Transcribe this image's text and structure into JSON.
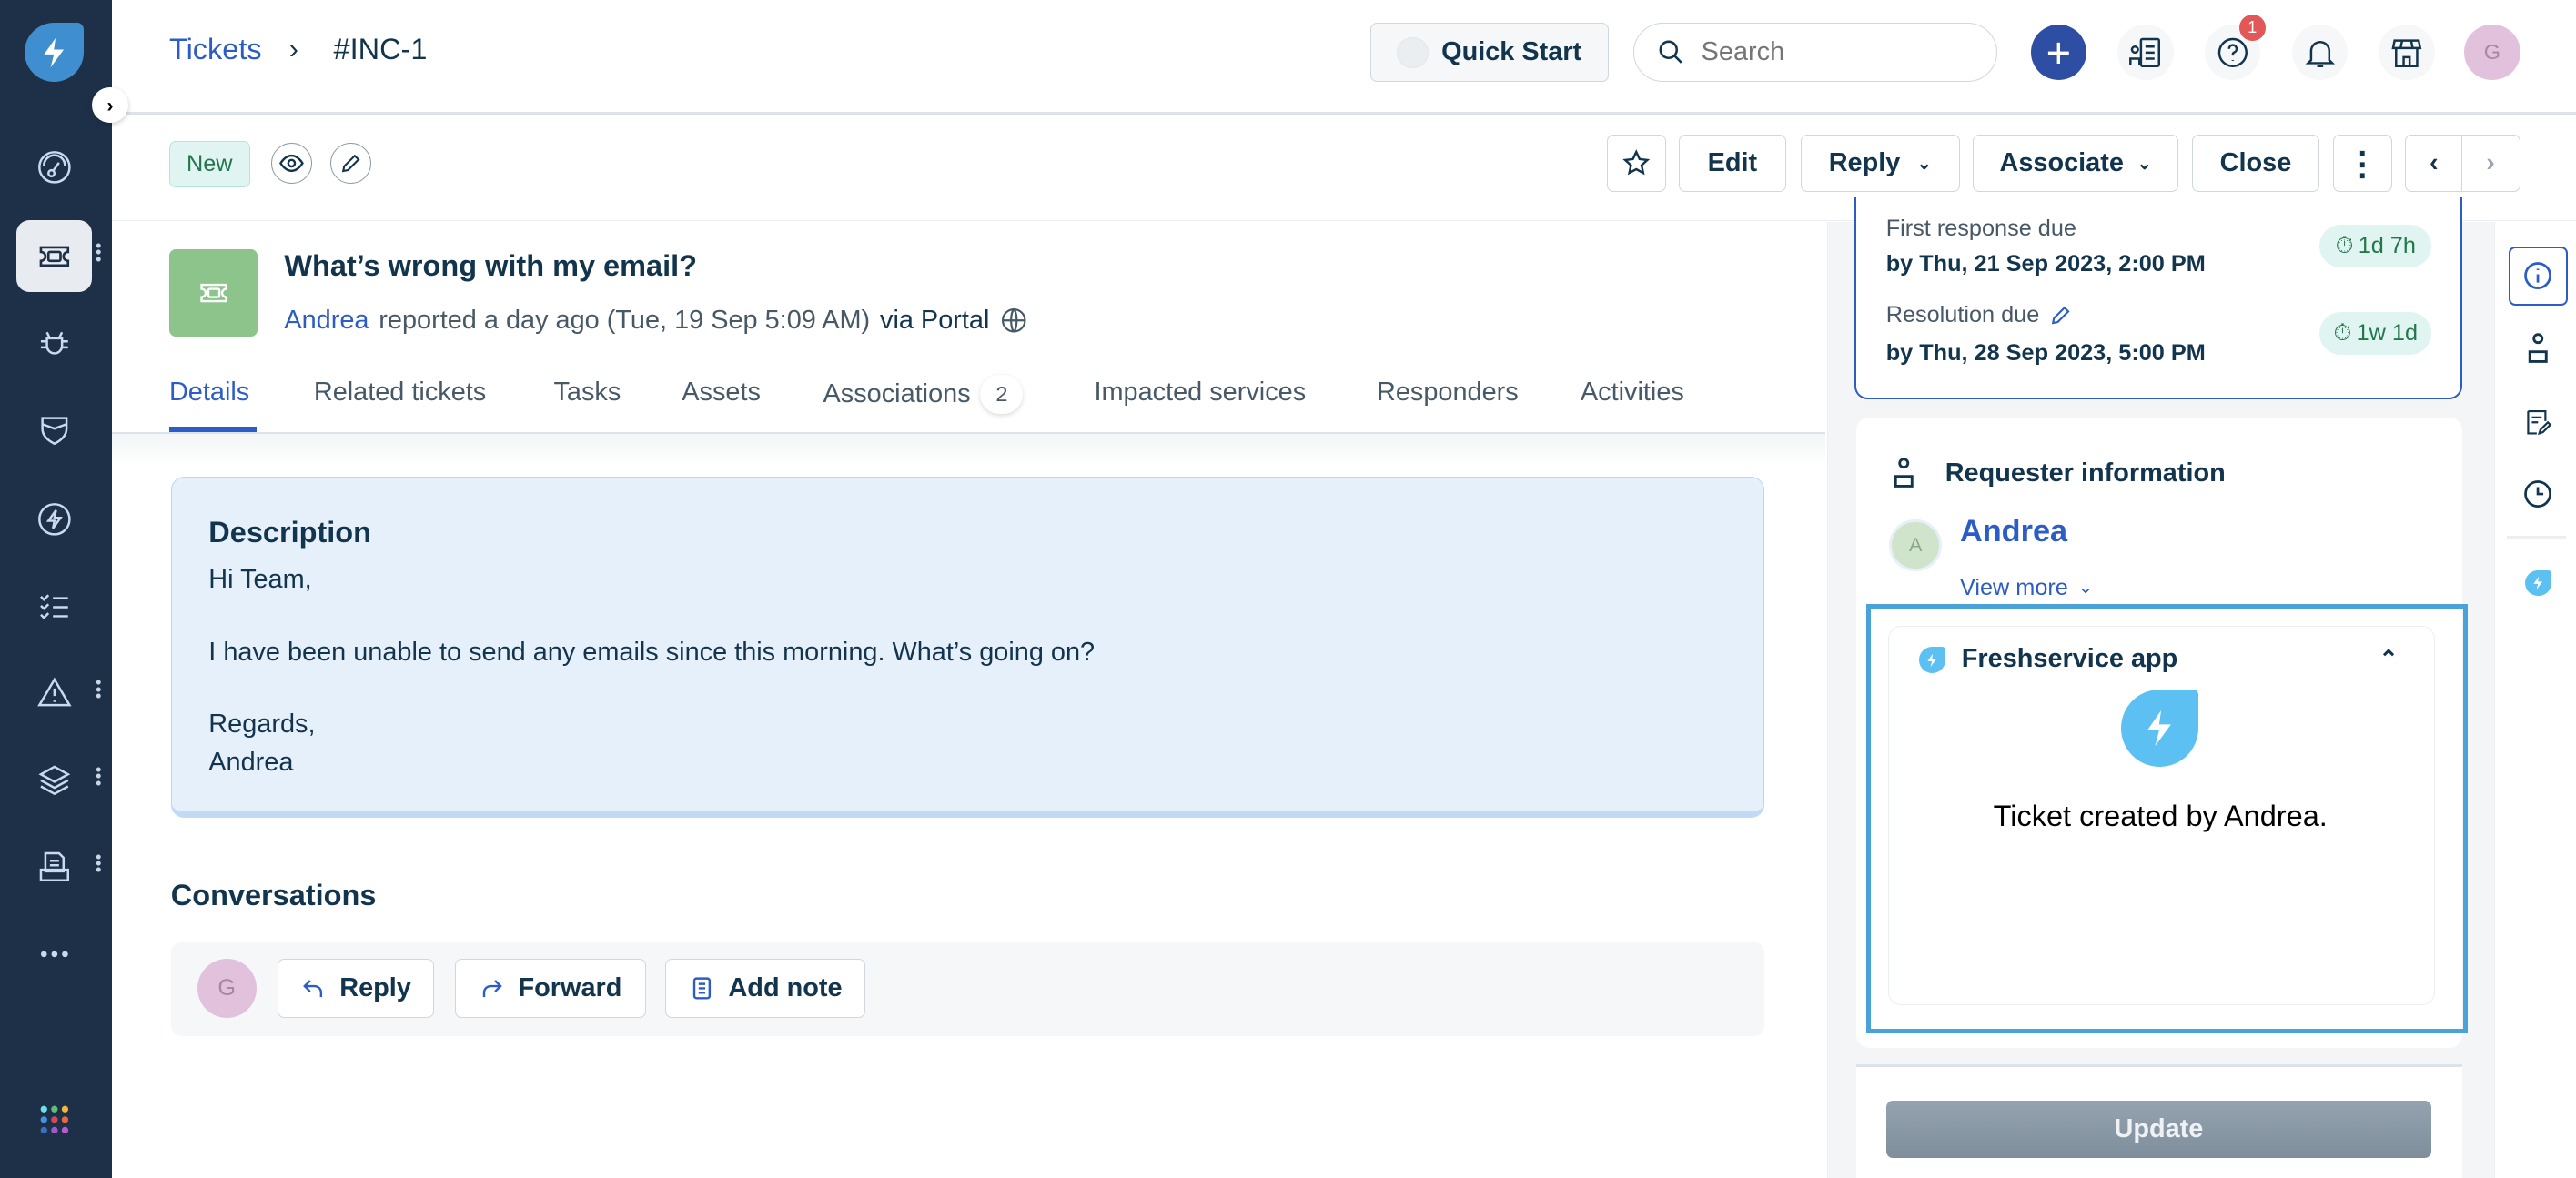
{
  "header": {
    "breadcrumb": {
      "parent": "Tickets",
      "separator": "›",
      "current": "#INC-1"
    },
    "quick_start": "Quick Start",
    "search_placeholder": "Search",
    "notification_badge": "1",
    "user_initial": "G"
  },
  "ticket_bar": {
    "status": "New",
    "buttons": {
      "edit": "Edit",
      "reply": "Reply",
      "associate": "Associate",
      "close": "Close"
    }
  },
  "ticket": {
    "subject": "What’s wrong with my email?",
    "requester": "Andrea",
    "reported_text": "reported a day ago (Tue, 19 Sep 5:09 AM)",
    "via_text": "via Portal"
  },
  "tabs": [
    {
      "label": "Details",
      "active": true
    },
    {
      "label": "Related tickets"
    },
    {
      "label": "Tasks"
    },
    {
      "label": "Assets"
    },
    {
      "label": "Associations",
      "count": "2"
    },
    {
      "label": "Impacted services"
    },
    {
      "label": "Responders"
    },
    {
      "label": "Activities"
    }
  ],
  "description": {
    "title": "Description",
    "lines": [
      "Hi Team,",
      "I have been unable to send any emails since this morning. What’s going on?",
      "Regards,",
      "Andrea"
    ]
  },
  "conversations": {
    "title": "Conversations",
    "avatar_initial": "G",
    "buttons": {
      "reply": "Reply",
      "forward": "Forward",
      "add_note": "Add note"
    }
  },
  "sla": {
    "first_response": {
      "label": "First response due",
      "date": "by Thu, 21 Sep 2023, 2:00 PM",
      "remaining": "1d 7h"
    },
    "resolution": {
      "label": "Resolution due",
      "date": "by Thu, 28 Sep 2023, 5:00 PM",
      "remaining": "1w 1d"
    }
  },
  "requester_info": {
    "title": "Requester information",
    "initial": "A",
    "name": "Andrea",
    "view_more": "View more"
  },
  "app_widget": {
    "title": "Freshservice app",
    "message": "Ticket created by Andrea."
  },
  "footer": {
    "update": "Update"
  },
  "colors": {
    "sidebar": "#1e3048",
    "accent": "#2c5cc5",
    "app_highlight": "#4aa3d8",
    "status_green": "#24774c"
  }
}
